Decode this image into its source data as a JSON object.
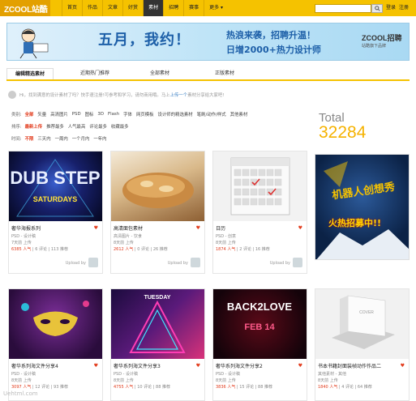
{
  "nav": {
    "logo": "ZCOOL站酷",
    "links": [
      "首页",
      "作品",
      "文章",
      "好赏",
      "素材",
      "招聘",
      "赛事",
      "更多"
    ],
    "active_index": 4,
    "search_placeholder": "",
    "login": "登录",
    "register": "注册"
  },
  "banner": {
    "title": "五月，我约！",
    "sub1": "热浪来袭，招聘升温！",
    "sub2": "日增2000+热力设计师",
    "brand": "ZCOOL招聘",
    "brand_sub": "站酷旗下品牌"
  },
  "tabs": [
    "编辑精选素材",
    "近期热门推荐",
    "全部素材",
    "正版素材"
  ],
  "hint": {
    "text": "Hi，找到满意的设计素材了吗？快手速注册!可参考和学习，请勿商用哦。马上",
    "link": "上传一个",
    "tail": "素材分享给大家吧!"
  },
  "filters": {
    "category": {
      "key": "类别:",
      "items": [
        "全部",
        "矢量",
        "高清图片",
        "PSD",
        "图标",
        "3D",
        "Flash",
        "字体",
        "网页模板",
        "设计师的精选素材",
        "笔刷/动作/样式",
        "其他素材"
      ]
    },
    "sort": {
      "key": "排序:",
      "items": [
        "最新上传",
        "推荐最多",
        "人气最高",
        "评论最多",
        "收藏最多"
      ]
    },
    "time": {
      "key": "时间:",
      "items": [
        "不限",
        "三天内",
        "一周内",
        "一个月内",
        "一年内"
      ]
    }
  },
  "total": {
    "label": "Total",
    "value": "32284"
  },
  "cards": [
    {
      "title": "奢华海报系列",
      "cat": "PSD - 设计稿",
      "age": "7天前 上传",
      "popularity": "6385 人气",
      "comments": "6 评论",
      "recs": "113 推荐",
      "upload": "Upload by"
    },
    {
      "title": "高清面包素材",
      "cat": "高清图片 - 饮食",
      "age": "8天前 上传",
      "popularity": "2612 人气",
      "comments": "0 评论",
      "recs": "26 推荐",
      "upload": "Upload by"
    },
    {
      "title": "日历",
      "cat": "PSD - 创意",
      "age": "8天前 上传",
      "popularity": "1874 人气",
      "comments": "2 评论",
      "recs": "16 推荐",
      "upload": "Upload by"
    },
    {
      "title": "奢华系列海文件分享4",
      "cat": "PSD - 设计稿",
      "age": "8天前 上传",
      "popularity": "3097 人气",
      "comments": "12 评论",
      "recs": "93 推荐",
      "upload": ""
    },
    {
      "title": "奢华系列海文件分享3",
      "cat": "PSD - 设计稿",
      "age": "8天前 上传",
      "popularity": "4755 人气",
      "comments": "10 评论",
      "recs": "88 推荐",
      "upload": ""
    },
    {
      "title": "奢华系列海文件分享2",
      "cat": "PSD - 设计稿",
      "age": "8天前 上传",
      "popularity": "3836 人气",
      "comments": "15 评论",
      "recs": "88 推荐",
      "upload": ""
    },
    {
      "title": "书本书籍封面装帧动作作品二",
      "cat": "其他素材 - 其他",
      "age": "8天前 上传",
      "popularity": "1840 人气",
      "comments": "4 评论",
      "recs": "64 推荐",
      "upload": ""
    }
  ],
  "card_art": [
    "DUB STEP",
    "SATURDAYS",
    "BACK2LOVE",
    "FEB 14",
    "COVER",
    "TUESDAY"
  ],
  "ad": {
    "line1": "机器人创想秀",
    "line2": "火热招募中!!"
  },
  "watermark": "Uehtml.com"
}
